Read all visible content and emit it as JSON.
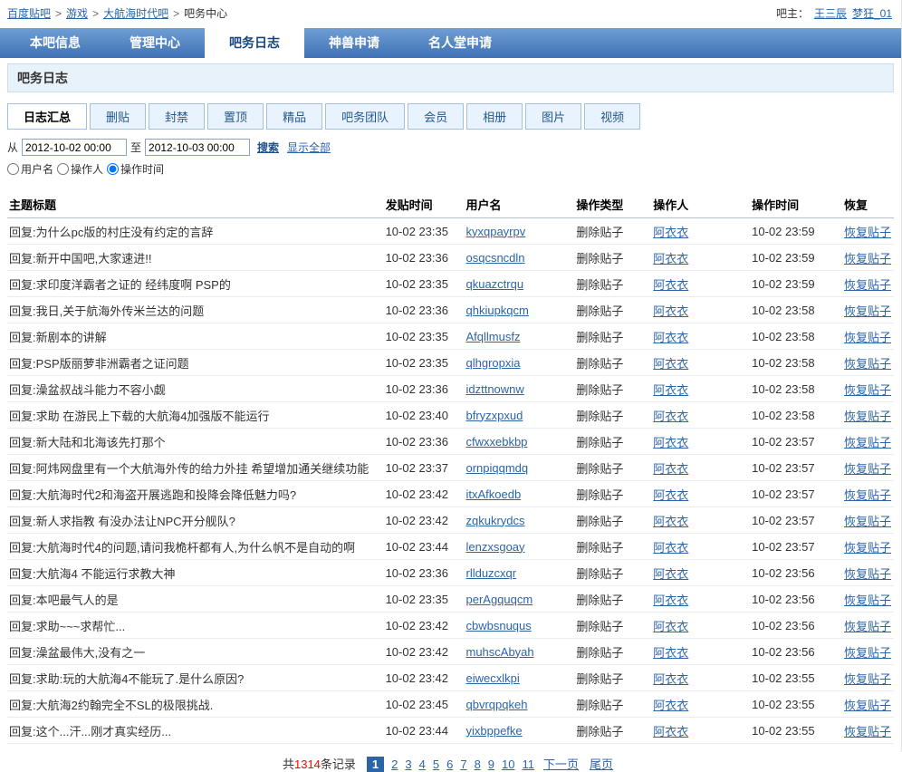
{
  "breadcrumb": {
    "separator": ">",
    "items": [
      {
        "label": "百度贴吧"
      },
      {
        "label": "游戏"
      },
      {
        "label": "大航海时代吧"
      },
      {
        "label": "吧务中心"
      }
    ],
    "owner_label": "吧主：",
    "owners": [
      "王三辰",
      "梦狂_01"
    ]
  },
  "nav": {
    "tabs": [
      {
        "label": "本吧信息",
        "active": false
      },
      {
        "label": "管理中心",
        "active": false
      },
      {
        "label": "吧务日志",
        "active": true
      },
      {
        "label": "神兽申请",
        "active": false
      },
      {
        "label": "名人堂申请",
        "active": false
      }
    ]
  },
  "page_title": "吧务日志",
  "log_tabs": [
    {
      "label": "日志汇总",
      "active": true
    },
    {
      "label": "删贴",
      "active": false
    },
    {
      "label": "封禁",
      "active": false
    },
    {
      "label": "置顶",
      "active": false
    },
    {
      "label": "精品",
      "active": false
    },
    {
      "label": "吧务团队",
      "active": false
    },
    {
      "label": "会员",
      "active": false
    },
    {
      "label": "相册",
      "active": false
    },
    {
      "label": "图片",
      "active": false
    },
    {
      "label": "视频",
      "active": false
    }
  ],
  "filter": {
    "from_label": "从",
    "from_value": "2012-10-02 00:00",
    "to_label": "至",
    "to_value": "2012-10-03 00:00",
    "search_label": "搜索",
    "show_all_label": "显示全部",
    "radios": [
      {
        "label": "用户名",
        "checked": false
      },
      {
        "label": "操作人",
        "checked": false
      },
      {
        "label": "操作时间",
        "checked": true
      }
    ]
  },
  "table": {
    "headers": [
      "主题标题",
      "发贴时间",
      "用户名",
      "操作类型",
      "操作人",
      "操作时间",
      "恢复"
    ],
    "rows": [
      {
        "title": "回复:为什么pc版的村庄没有约定的言辞",
        "post_time": "10-02 23:35",
        "username": "kyxqpayrpv",
        "op_type": "删除贴子",
        "operator": "阿衣衣",
        "op_time": "10-02 23:59",
        "restore": "恢复贴子"
      },
      {
        "title": "回复:新开中国吧,大家速进!!",
        "post_time": "10-02 23:36",
        "username": "osqcsncdln",
        "op_type": "删除贴子",
        "operator": "阿衣衣",
        "op_time": "10-02 23:59",
        "restore": "恢复贴子"
      },
      {
        "title": "回复:求印度洋霸者之证的 经纬度啊 PSP的",
        "post_time": "10-02 23:35",
        "username": "qkuazctrqu",
        "op_type": "删除贴子",
        "operator": "阿衣衣",
        "op_time": "10-02 23:59",
        "restore": "恢复贴子"
      },
      {
        "title": "回复:我日,关于航海外传米兰达的问题",
        "post_time": "10-02 23:36",
        "username": "qhkiupkqcm",
        "op_type": "删除贴子",
        "operator": "阿衣衣",
        "op_time": "10-02 23:58",
        "restore": "恢复贴子"
      },
      {
        "title": "回复:新剧本的讲解",
        "post_time": "10-02 23:35",
        "username": "Afqllmusfz",
        "op_type": "删除贴子",
        "operator": "阿衣衣",
        "op_time": "10-02 23:58",
        "restore": "恢复贴子"
      },
      {
        "title": "回复:PSP版丽萝非洲霸者之证问题",
        "post_time": "10-02 23:35",
        "username": "qlhgropxia",
        "op_type": "删除贴子",
        "operator": "阿衣衣",
        "op_time": "10-02 23:58",
        "restore": "恢复贴子"
      },
      {
        "title": "回复:澡盆叔战斗能力不容小觑",
        "post_time": "10-02 23:36",
        "username": "idzttnownw",
        "op_type": "删除贴子",
        "operator": "阿衣衣",
        "op_time": "10-02 23:58",
        "restore": "恢复贴子"
      },
      {
        "title": "回复:求助 在游民上下载的大航海4加强版不能运行",
        "post_time": "10-02 23:40",
        "username": "bfryzxpxud",
        "op_type": "删除贴子",
        "operator": "阿衣衣",
        "op_time": "10-02 23:58",
        "restore": "恢复贴子"
      },
      {
        "title": "回复:新大陆和北海该先打那个",
        "post_time": "10-02 23:36",
        "username": "cfwxxebkbp",
        "op_type": "删除贴子",
        "operator": "阿衣衣",
        "op_time": "10-02 23:57",
        "restore": "恢复贴子"
      },
      {
        "title": "回复:阿炜网盘里有一个大航海外传的给力外挂 希望增加通关继续功能",
        "post_time": "10-02 23:37",
        "username": "ornpiqqmdq",
        "op_type": "删除贴子",
        "operator": "阿衣衣",
        "op_time": "10-02 23:57",
        "restore": "恢复贴子"
      },
      {
        "title": "回复:大航海时代2和海盗开展逃跑和投降会降低魅力吗?",
        "post_time": "10-02 23:42",
        "username": "itxAfkoedb",
        "op_type": "删除贴子",
        "operator": "阿衣衣",
        "op_time": "10-02 23:57",
        "restore": "恢复贴子"
      },
      {
        "title": "回复:新人求指教 有没办法让NPC开分舰队?",
        "post_time": "10-02 23:42",
        "username": "zqkukrydcs",
        "op_type": "删除贴子",
        "operator": "阿衣衣",
        "op_time": "10-02 23:57",
        "restore": "恢复贴子"
      },
      {
        "title": "回复:大航海时代4的问题,请问我桅杆都有人,为什么帆不是自动的啊",
        "post_time": "10-02 23:44",
        "username": "lenzxsgoay",
        "op_type": "删除贴子",
        "operator": "阿衣衣",
        "op_time": "10-02 23:57",
        "restore": "恢复贴子"
      },
      {
        "title": "回复:大航海4 不能运行求教大神",
        "post_time": "10-02 23:36",
        "username": "rllduzcxqr",
        "op_type": "删除贴子",
        "operator": "阿衣衣",
        "op_time": "10-02 23:56",
        "restore": "恢复贴子"
      },
      {
        "title": "回复:本吧最气人的是",
        "post_time": "10-02 23:35",
        "username": "perAgquqcm",
        "op_type": "删除贴子",
        "operator": "阿衣衣",
        "op_time": "10-02 23:56",
        "restore": "恢复贴子"
      },
      {
        "title": "回复:求助~~~求帮忙...",
        "post_time": "10-02 23:42",
        "username": "cbwbsnuqus",
        "op_type": "删除贴子",
        "operator": "阿衣衣",
        "op_time": "10-02 23:56",
        "restore": "恢复贴子"
      },
      {
        "title": "回复:澡盆最伟大,没有之一",
        "post_time": "10-02 23:42",
        "username": "muhscAbyah",
        "op_type": "删除贴子",
        "operator": "阿衣衣",
        "op_time": "10-02 23:56",
        "restore": "恢复贴子"
      },
      {
        "title": "回复:求助:玩的大航海4不能玩了.是什么原因?",
        "post_time": "10-02 23:42",
        "username": "eiwecxlkpi",
        "op_type": "删除贴子",
        "operator": "阿衣衣",
        "op_time": "10-02 23:55",
        "restore": "恢复贴子"
      },
      {
        "title": "回复:大航海2约翰完全不SL的极限挑战.",
        "post_time": "10-02 23:45",
        "username": "qbvrqpqkeh",
        "op_type": "删除贴子",
        "operator": "阿衣衣",
        "op_time": "10-02 23:55",
        "restore": "恢复贴子"
      },
      {
        "title": "回复:这个...汗...刚才真实经历...",
        "post_time": "10-02 23:44",
        "username": "yixbppefke",
        "op_type": "删除贴子",
        "operator": "阿衣衣",
        "op_time": "10-02 23:55",
        "restore": "恢复贴子"
      }
    ]
  },
  "pagination": {
    "total_prefix": "共",
    "total_count": "1314",
    "total_suffix": "条记录",
    "pages": [
      "1",
      "2",
      "3",
      "4",
      "5",
      "6",
      "7",
      "8",
      "9",
      "10",
      "11"
    ],
    "current_page": "1",
    "next_label": "下一页",
    "last_label": "尾页"
  }
}
